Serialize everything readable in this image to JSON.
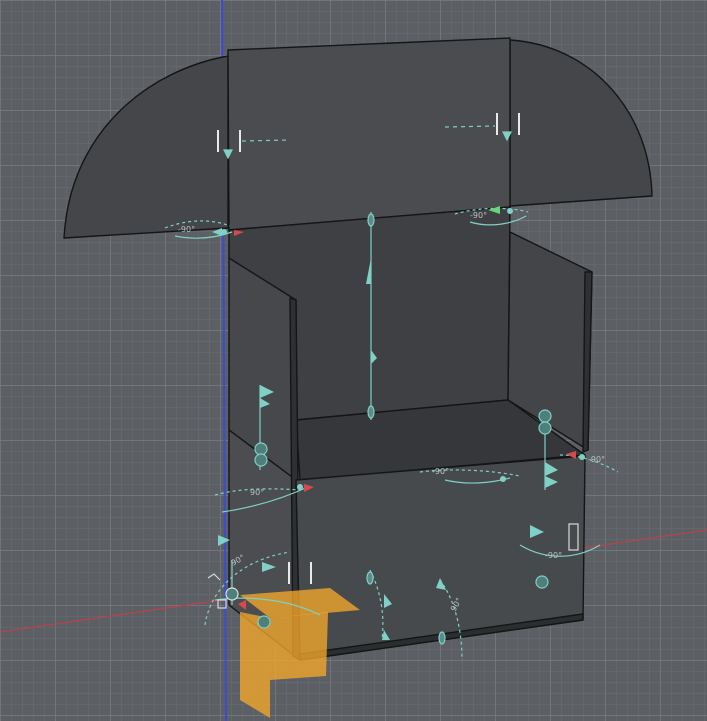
{
  "viewport": {
    "background": "#5c5f63",
    "grid_minor_color": "#6a6d71",
    "grid_major_color": "#7a7e83",
    "axis_x_color": "#b2464b",
    "axis_y_color": "#3b4bd8"
  },
  "model": {
    "face_color": "#45474a",
    "face_dark_color": "#3a3c3f",
    "edge_color": "#141516",
    "selection_color": "#f3a72a"
  },
  "manipulators": {
    "color": "#7fd0c5",
    "angle_labels": [
      "-90°",
      "-90°",
      "90°",
      "-90°",
      "-90°",
      "-90°",
      "90°",
      "90°"
    ]
  }
}
